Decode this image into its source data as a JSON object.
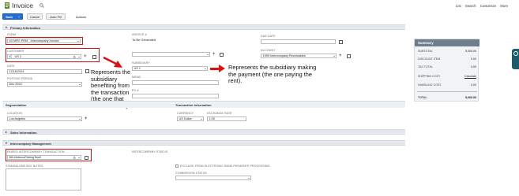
{
  "header": {
    "title": "Invoice",
    "links": [
      "List",
      "Search",
      "Customize",
      "More"
    ]
  },
  "toolbar": {
    "save_label": "Save",
    "cancel_label": "Cancel",
    "autofill_label": "Auto Fill",
    "actions_label": "Actions"
  },
  "primary": {
    "section_title": "Primary Information",
    "form_label": "FORM",
    "form_value": "53 MRG PRM - Intercompany Invoice",
    "customer_label": "CUSTOMER",
    "customer_value": "IC - US 2",
    "date_label": "DATE",
    "date_value": "12/16/2024",
    "posting_label": "POSTING PERIOD",
    "posting_value": "Dec 2024",
    "invoice_label": "INVOICE #",
    "invoice_value": "To Be Generated",
    "subsidiary_label": "SUBSIDIARY",
    "subsidiary_value": "US 1",
    "memo_label": "MEMO",
    "po_label": "PO #",
    "due_label": "DUE DATE",
    "account_label": "ACCOUNT",
    "account_value": "1999 Intercompany Receivables"
  },
  "annotations": {
    "customer_note": "Represents the subsidiary benefiting from the transaction (the one that owes the rent).",
    "subsidiary_note": "Represents the subsidiary making the payment (the one paying the rent)."
  },
  "summary": {
    "title": "Summary",
    "rows": [
      {
        "label": "SUBTOTAL",
        "value": "5,000.00"
      },
      {
        "label": "DISCOUNT ITEM",
        "value": "0.00"
      },
      {
        "label": "TAX TOTAL",
        "value": "0.00"
      },
      {
        "label": "SHIPPING COST",
        "value": "Calculate"
      },
      {
        "label": "HANDLING COST",
        "value": "0.00"
      },
      {
        "label": "TOTAL",
        "value": "5,000.00"
      }
    ]
  },
  "segmentation": {
    "title": "Segmentation",
    "location_label": "LOCATION",
    "location_value": "Los Angeles"
  },
  "transaction": {
    "title": "Transaction Information",
    "currency_label": "CURRENCY",
    "currency_value": "US Dollar",
    "exchange_label": "EXCHANGE RATE",
    "exchange_value": "1.00"
  },
  "sales": {
    "section_title": "Sales Information"
  },
  "intercompany": {
    "section_title": "Intercompany Management",
    "paired_label": "PAIRED INTERCOMPANY TRANSACTION",
    "paired_value": "Bill #IntercoPairingTest2",
    "status_label": "INTERCOMPANY STATUS",
    "notes_label": "STANDALONE BOL NOTES",
    "exclude_label": "EXCLUDE FROM ELECTRONIC BANK PAYMENTS PROCESSING",
    "commission_label": "COMMISSION STATUS"
  },
  "colors": {
    "save_blue": "#1f6ed4",
    "annotation_red": "#cc1111",
    "section_bg": "#e5e9ee",
    "summary_header": "#6f7e8f",
    "summary_bg": "#f1f3f5",
    "side_widget": "#1c5b6a"
  }
}
